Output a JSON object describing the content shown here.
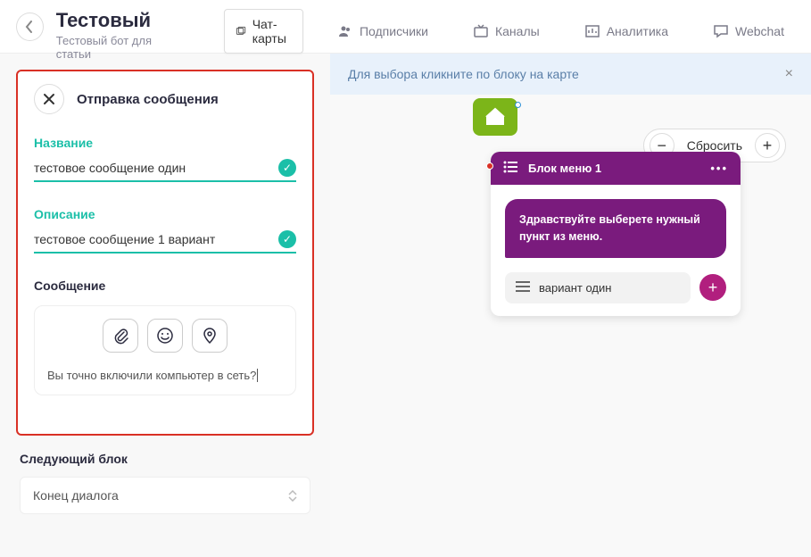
{
  "header": {
    "title": "Тестовый",
    "subtitle": "Тестовый бот для статьи",
    "tabs": {
      "chat_maps": "Чат-карты",
      "subscribers": "Подписчики",
      "channels": "Каналы",
      "analytics": "Аналитика",
      "webchat": "Webchat"
    }
  },
  "info_bar": "Для выбора кликните по блоку на карте",
  "panel": {
    "title": "Отправка сообщения",
    "name_label": "Название",
    "name_value": "тестовое сообщение один",
    "desc_label": "Описание",
    "desc_value": "тестовое сообщение 1 вариант",
    "message_label": "Сообщение",
    "message_text": "Вы точно включили компьютер в сеть?"
  },
  "next_block": {
    "label": "Следующий блок",
    "value": "Конец диалога"
  },
  "canvas": {
    "reset_label": "Сбросить",
    "menu_block": {
      "title": "Блок меню 1",
      "bubble": "Здравствуйте выберете нужный пункт из меню.",
      "option": "вариант один"
    }
  }
}
